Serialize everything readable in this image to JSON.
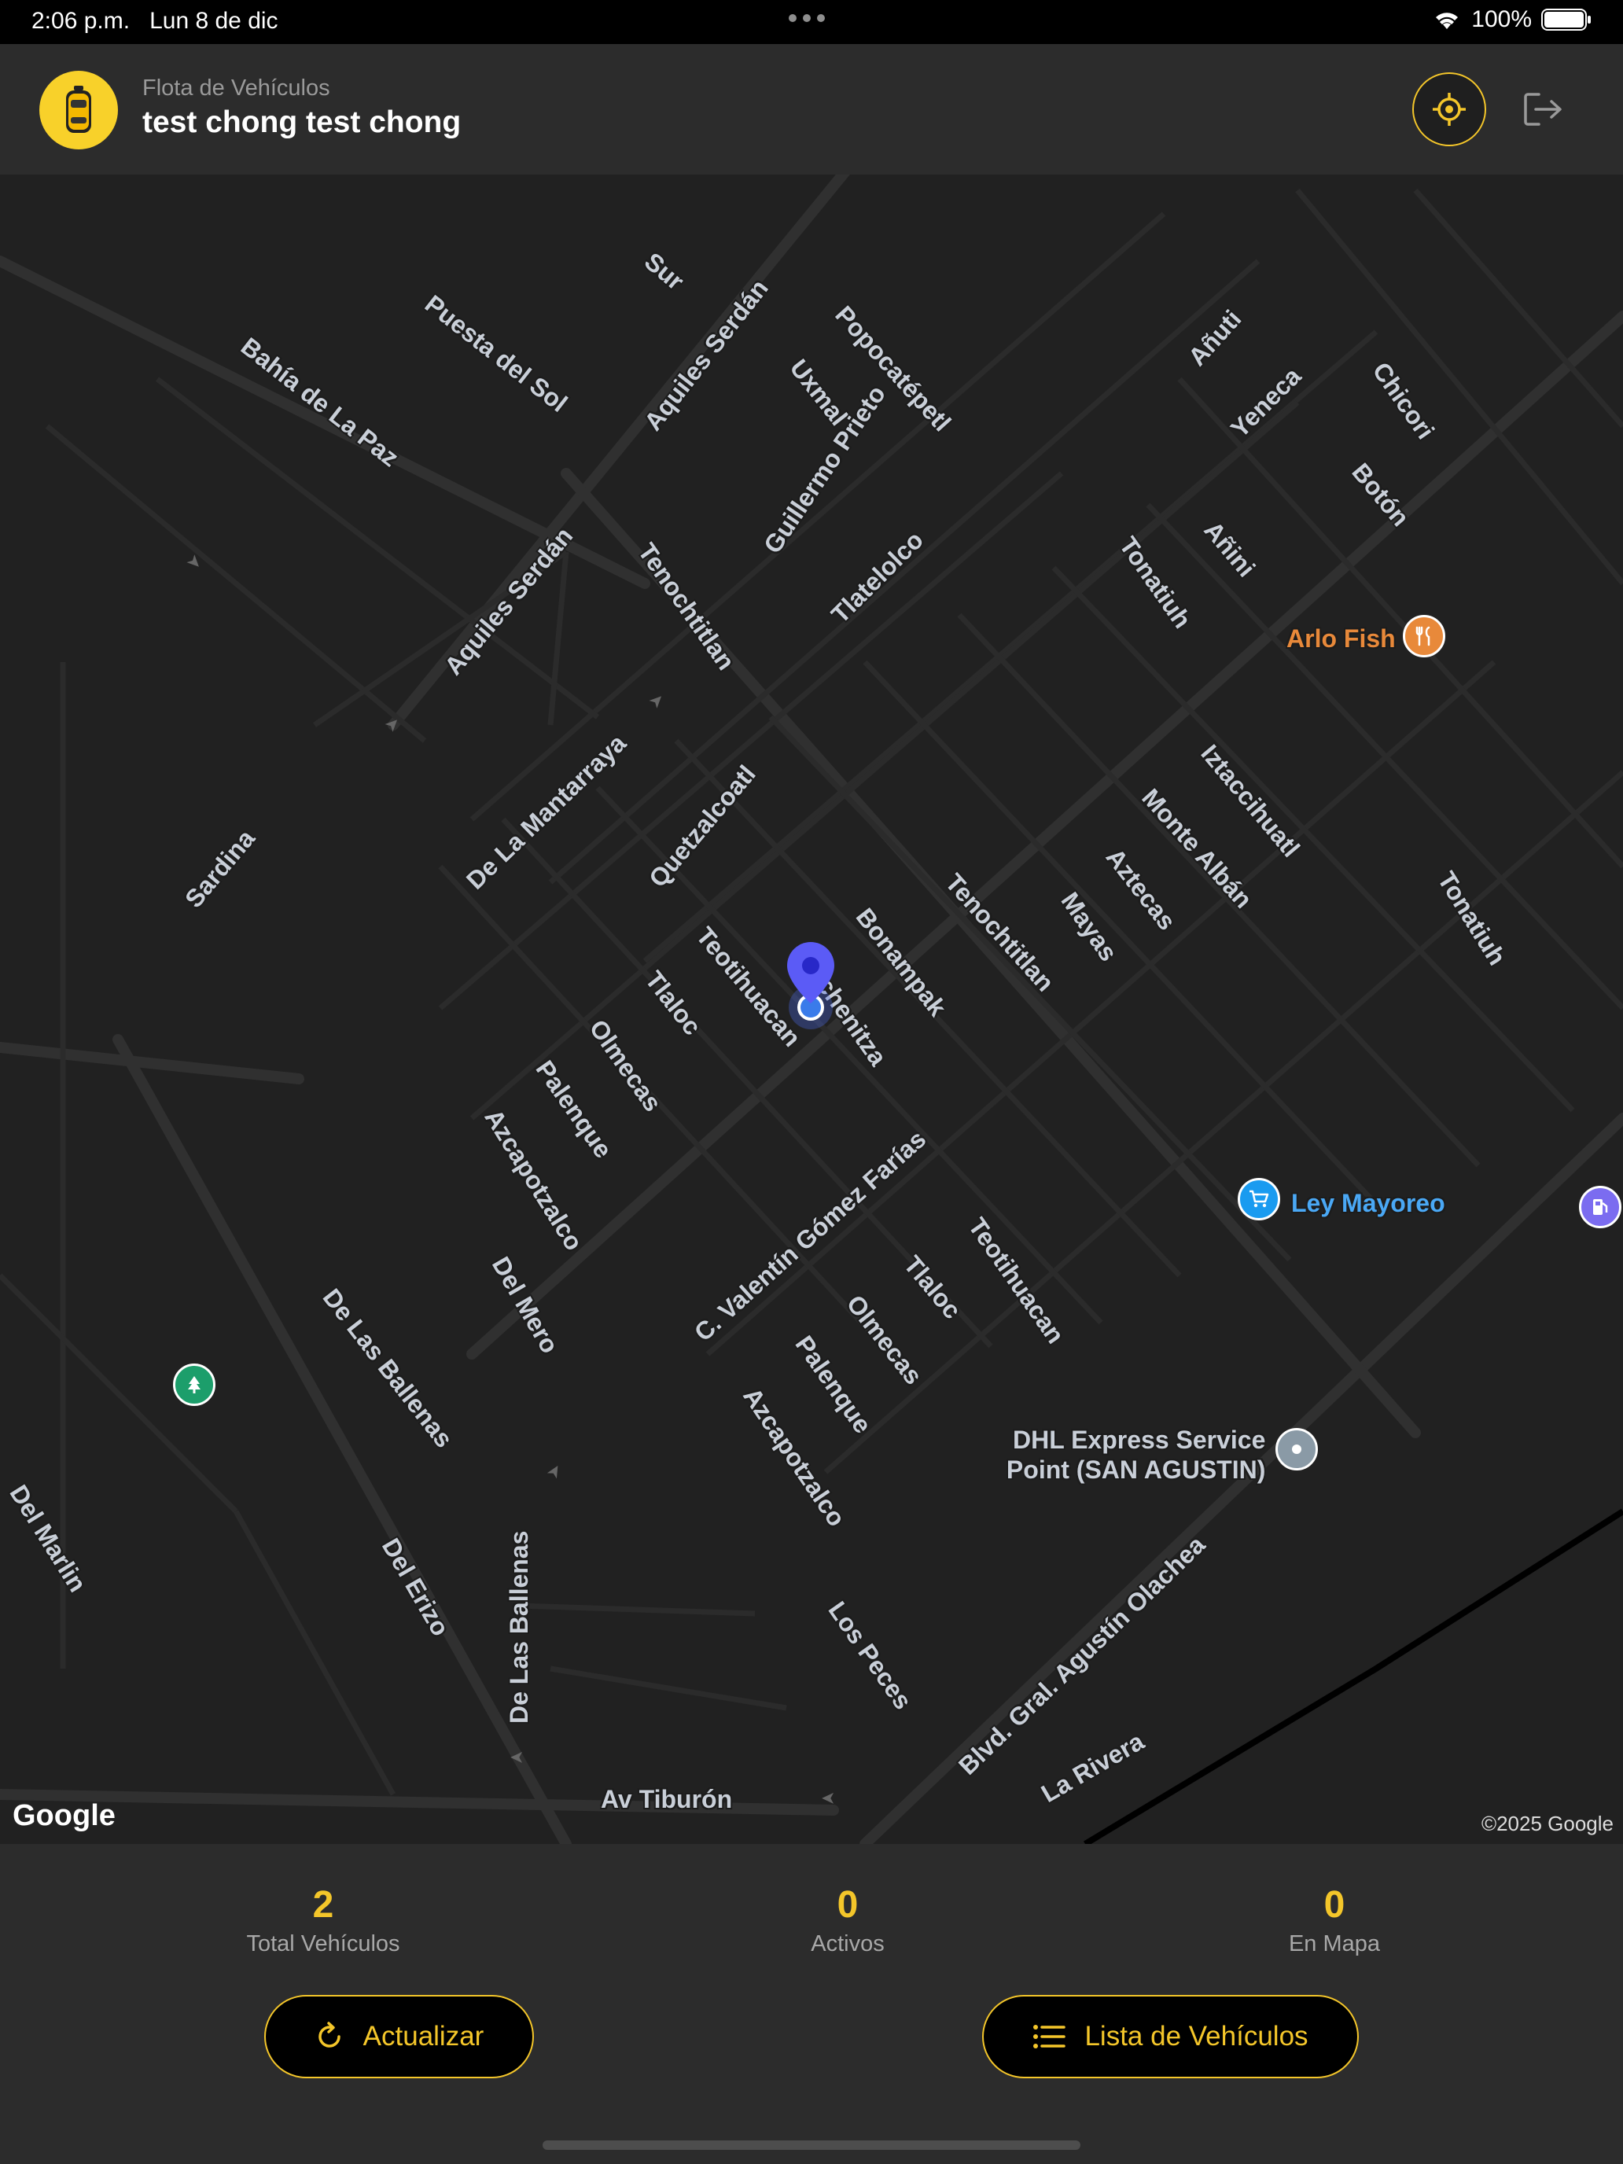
{
  "status_bar": {
    "time": "2:06 p.m.",
    "date": "Lun 8 de dic",
    "battery": "100%"
  },
  "header": {
    "subtitle": "Flota de Vehículos",
    "title": "test chong test chong"
  },
  "map": {
    "streets": [
      "Sur",
      "Puesta del Sol",
      "Bahía de La Paz",
      "Aquiles Serdán",
      "Uxmal",
      "Popocatépetl",
      "Guillermo Prieto",
      "Tenochtitlan",
      "Tlatelolco",
      "Quetzalcoatl",
      "De La Mantarraya",
      "Sardina",
      "Teotihuacan",
      "Chichenitza",
      "Bonampak",
      "Tlaloc",
      "Olmecas",
      "Palenque",
      "Azcapotzalco",
      "Mayas",
      "Aztecas",
      "Monte Albán",
      "Iztaccihuatl",
      "Tonatiuh",
      "Añuti",
      "Yeneca",
      "Chicori",
      "Botón",
      "Añini",
      "C. Valentín Gómez Farías",
      "Del Mero",
      "De Las Ballenas",
      "Del Marlin",
      "Del Erizo",
      "Los Peces",
      "Blvd. Gral. Agustín Olachea",
      "La Rivera",
      "Av Tiburón"
    ],
    "pois": {
      "arlo_fish": "Arlo Fish",
      "ley_mayoreo": "Ley Mayoreo",
      "dhl_line1": "DHL Express Service",
      "dhl_line2": "Point (SAN AGUSTIN)"
    },
    "google": "Google",
    "copyright": "©2025 Google"
  },
  "stats": [
    {
      "value": "2",
      "label": "Total Vehículos"
    },
    {
      "value": "0",
      "label": "Activos"
    },
    {
      "value": "0",
      "label": "En Mapa"
    }
  ],
  "buttons": {
    "refresh": "Actualizar",
    "vehicle_list": "Lista de Vehículos"
  },
  "colors": {
    "accent": "#f4c62a",
    "map_bg": "#212121",
    "pin": "#5b5bf6"
  }
}
